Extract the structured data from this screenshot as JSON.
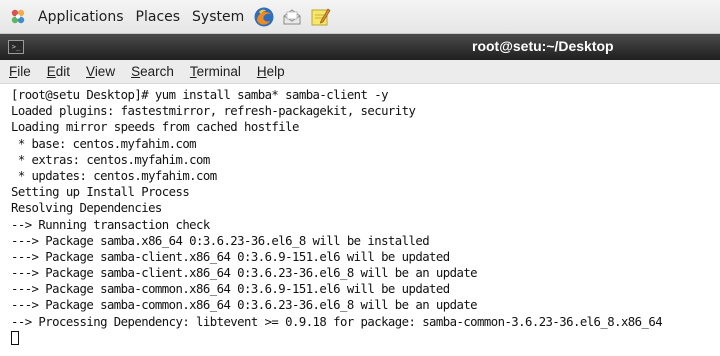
{
  "panel": {
    "menus": [
      "Applications",
      "Places",
      "System"
    ],
    "launchers": [
      "firefox-icon",
      "mail-icon",
      "notes-icon"
    ]
  },
  "window": {
    "title": "root@setu:~/Desktop"
  },
  "menubar": {
    "items": [
      {
        "mnemonic": "F",
        "rest": "ile"
      },
      {
        "mnemonic": "E",
        "rest": "dit"
      },
      {
        "mnemonic": "V",
        "rest": "iew"
      },
      {
        "mnemonic": "S",
        "rest": "earch"
      },
      {
        "mnemonic": "T",
        "rest": "erminal"
      },
      {
        "mnemonic": "H",
        "rest": "elp"
      }
    ]
  },
  "terminal": {
    "lines": [
      "[root@setu Desktop]# yum install samba* samba-client -y",
      "Loaded plugins: fastestmirror, refresh-packagekit, security",
      "Loading mirror speeds from cached hostfile",
      " * base: centos.myfahim.com",
      " * extras: centos.myfahim.com",
      " * updates: centos.myfahim.com",
      "Setting up Install Process",
      "Resolving Dependencies",
      "--> Running transaction check",
      "---> Package samba.x86_64 0:3.6.23-36.el6_8 will be installed",
      "---> Package samba-client.x86_64 0:3.6.9-151.el6 will be updated",
      "---> Package samba-client.x86_64 0:3.6.23-36.el6_8 will be an update",
      "---> Package samba-common.x86_64 0:3.6.9-151.el6 will be updated",
      "---> Package samba-common.x86_64 0:3.6.23-36.el6_8 will be an update",
      "--> Processing Dependency: libtevent >= 0.9.18 for package: samba-common-3.6.23-36.el6_8.x86_64"
    ]
  }
}
